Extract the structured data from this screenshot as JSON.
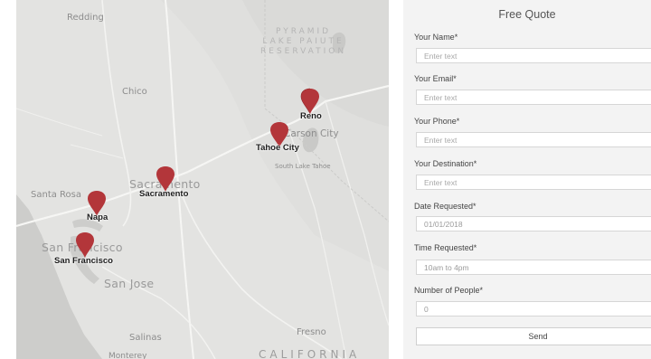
{
  "map": {
    "region_label_lines": [
      "PYRAMID",
      "LAKE PAIUTE",
      "RESERVATION"
    ],
    "cities": [
      {
        "id": "redding",
        "label": "Redding",
        "style": "normal"
      },
      {
        "id": "chico",
        "label": "Chico",
        "style": "normal"
      },
      {
        "id": "carson",
        "label": "Carson City",
        "style": "big"
      },
      {
        "id": "southlake",
        "label": "South Lake Tahoe",
        "style": "normal"
      },
      {
        "id": "sacramento-base",
        "label": "Sacramento",
        "style": "big"
      },
      {
        "id": "santarosa",
        "label": "Santa Rosa",
        "style": "normal"
      },
      {
        "id": "sanfrancisco-base",
        "label": "San Francisco",
        "style": "big"
      },
      {
        "id": "sanjose",
        "label": "San Jose",
        "style": "big"
      },
      {
        "id": "salinas",
        "label": "Salinas",
        "style": "normal"
      },
      {
        "id": "fresno",
        "label": "Fresno",
        "style": "normal"
      },
      {
        "id": "monterey",
        "label": "Monterey",
        "style": "normal"
      },
      {
        "id": "california",
        "label": "CALIFORNIA",
        "style": "huge"
      }
    ],
    "markers": [
      {
        "id": "reno",
        "label": "Reno"
      },
      {
        "id": "tahoe",
        "label": "Tahoe City"
      },
      {
        "id": "sacramento",
        "label": "Sacramento"
      },
      {
        "id": "napa",
        "label": "Napa"
      },
      {
        "id": "sanfrancisco",
        "label": "San Francisco"
      }
    ],
    "colors": {
      "marker": "#b3363a",
      "land": "#e3e3e1",
      "water": "#c8c8c6",
      "road": "#f5f5f3"
    }
  },
  "form": {
    "title": "Free Quote",
    "fields": [
      {
        "label": "Your Name*",
        "placeholder": "Enter text",
        "value": ""
      },
      {
        "label": "Your Email*",
        "placeholder": "Enter text",
        "value": ""
      },
      {
        "label": "Your Phone*",
        "placeholder": "Enter text",
        "value": ""
      },
      {
        "label": "Your Destination*",
        "placeholder": "Enter text",
        "value": ""
      },
      {
        "label": "Date Requested*",
        "placeholder": "",
        "value": "01/01/2018"
      },
      {
        "label": "Time Requested*",
        "placeholder": "",
        "value": "10am to 4pm"
      },
      {
        "label": "Number of People*",
        "placeholder": "",
        "value": "0"
      }
    ],
    "send_label": "Send"
  }
}
